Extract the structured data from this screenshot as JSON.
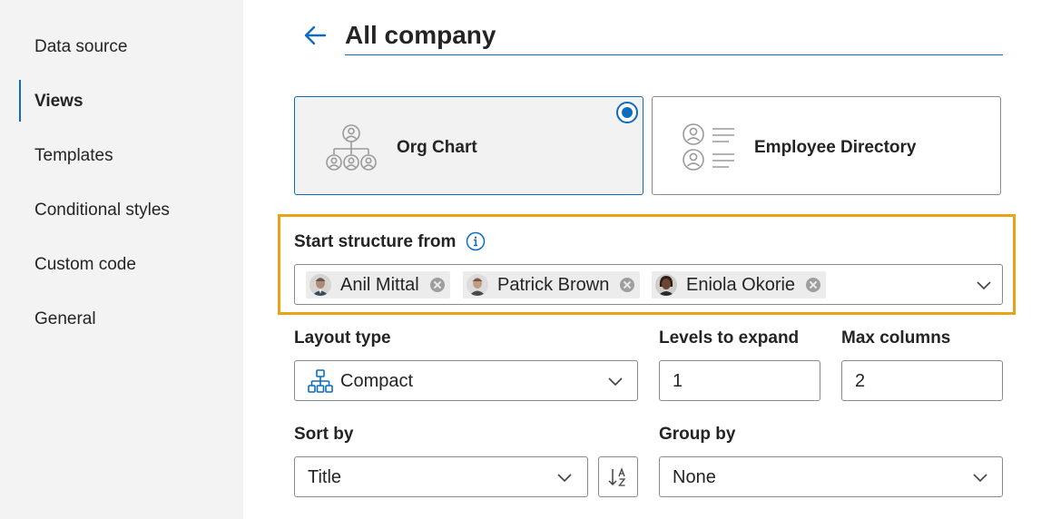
{
  "sidebar": {
    "items": [
      {
        "label": "Data source",
        "active": false
      },
      {
        "label": "Views",
        "active": true
      },
      {
        "label": "Templates",
        "active": false
      },
      {
        "label": "Conditional styles",
        "active": false
      },
      {
        "label": "Custom code",
        "active": false
      },
      {
        "label": "General",
        "active": false
      }
    ]
  },
  "header": {
    "title": "All company",
    "back_icon": "arrow-left-icon"
  },
  "views": {
    "options": [
      {
        "label": "Org Chart",
        "icon": "org-chart-icon",
        "selected": true
      },
      {
        "label": "Employee Directory",
        "icon": "directory-icon",
        "selected": false
      }
    ]
  },
  "start_structure": {
    "label": "Start structure from",
    "info_icon": "info-icon",
    "people": [
      {
        "name": "Anil Mittal"
      },
      {
        "name": "Patrick Brown"
      },
      {
        "name": "Eniola Okorie"
      }
    ]
  },
  "layout_type": {
    "label": "Layout type",
    "value": "Compact",
    "icon": "hierarchy-icon"
  },
  "levels_to_expand": {
    "label": "Levels to expand",
    "value": "1"
  },
  "max_columns": {
    "label": "Max columns",
    "value": "2"
  },
  "sort_by": {
    "label": "Sort by",
    "value": "Title",
    "sort_icon": "sort-ascending-icon"
  },
  "group_by": {
    "label": "Group by",
    "value": "None"
  },
  "colors": {
    "accent": "#0f6cbd",
    "highlight": "#e8a317",
    "sidebar_bg": "#f3f3f3"
  }
}
